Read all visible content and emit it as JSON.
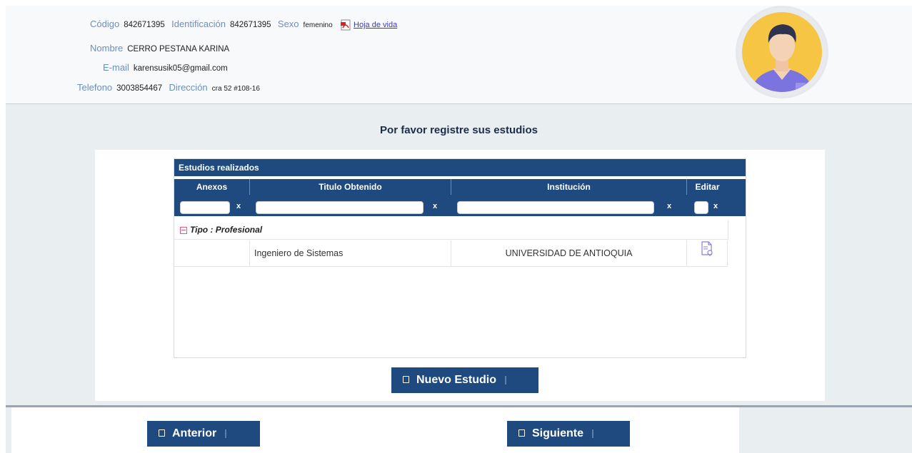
{
  "header": {
    "codigo_label": "Código",
    "codigo_value": "842671395",
    "identificacion_label": "Identificación",
    "identificacion_value": "842671395",
    "sexo_label": "Sexo",
    "sexo_value": "femenino",
    "cv_link": "Hoja de vida",
    "nombre_label": "Nombre",
    "nombre_value": "CERRO PESTANA KARINA",
    "email_label": "E-mail",
    "email_value": "karensusik05@gmail.com",
    "telefono_label": "Telefono",
    "telefono_value": "3003854467",
    "direccion_label": "Dirección",
    "direccion_value": "cra 52 #108-16"
  },
  "page": {
    "title": "Por favor registre sus estudios"
  },
  "grid": {
    "caption": "Estudios realizados",
    "columns": [
      "Anexos",
      "Titulo Obtenido",
      "Institución",
      "Editar"
    ],
    "filter_clear": "x",
    "group_label": "Tipo : Profesional",
    "rows": [
      {
        "anexos": "",
        "titulo": "Ingeniero de Sistemas",
        "institucion": "UNIVERSIDAD DE ANTIOQUIA"
      }
    ]
  },
  "buttons": {
    "new_study": "Nuevo Estudio",
    "previous": "Anterior",
    "next": "Siguiente"
  },
  "colors": {
    "primary": "#1f4a7f",
    "label": "#6b8fc0",
    "band": "#e9eef1"
  },
  "icons": {
    "pdf": "pdf-icon",
    "avatar": "user-avatar",
    "edit": "edit-document-icon",
    "group_toggle": "collapse-icon",
    "button_icon": "document-icon"
  }
}
